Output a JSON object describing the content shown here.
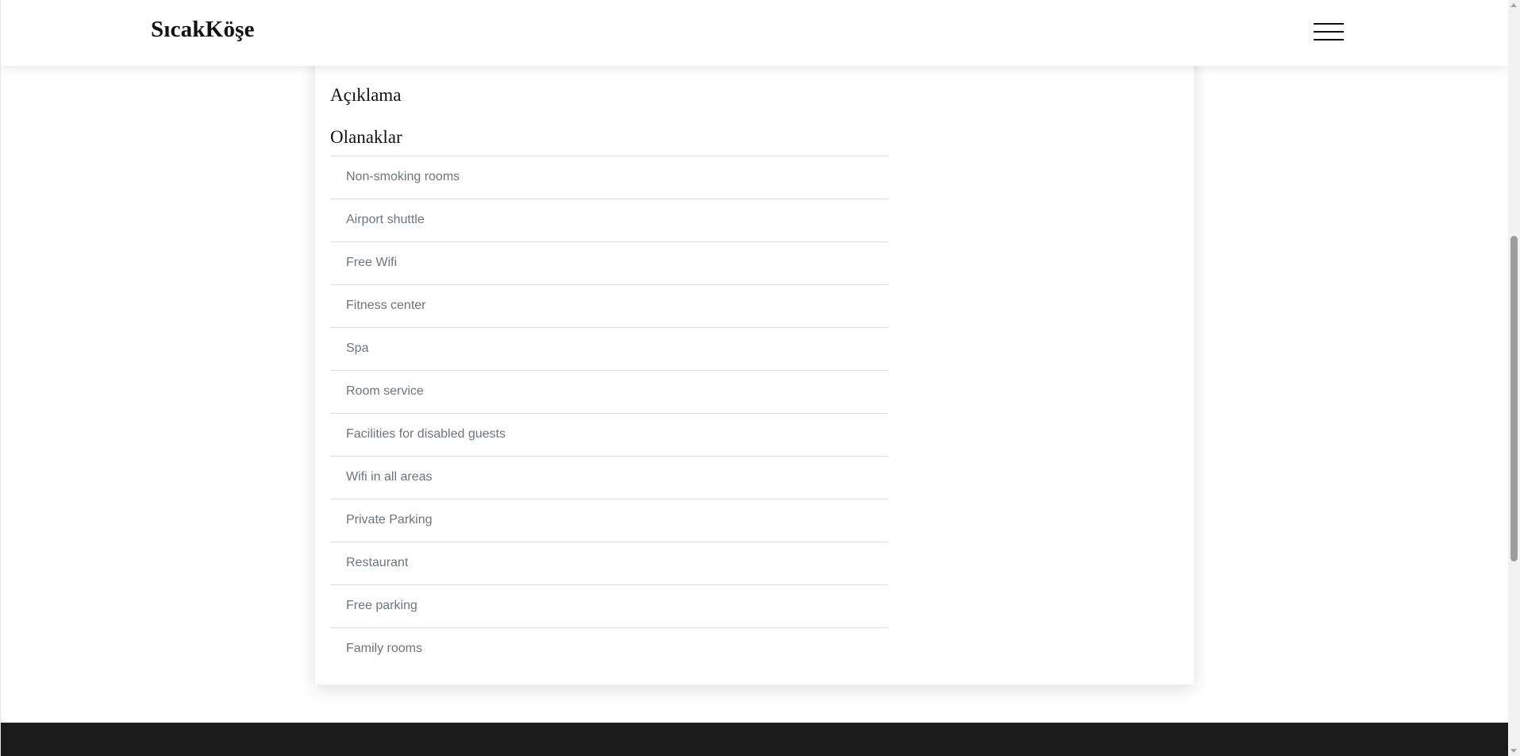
{
  "navbar": {
    "brand": "SıcakKöşe",
    "menu_icon": "hamburger-menu-icon"
  },
  "details": {
    "description_heading": "Açıklama",
    "amenities_heading": "Olanaklar",
    "amenities": [
      "Non-smoking rooms",
      "Airport shuttle",
      "Free Wifi",
      "Fitness center",
      "Spa",
      "Room service",
      "Facilities for disabled guests",
      "Wifi in all areas",
      "Private Parking",
      "Restaurant",
      "Free parking",
      "Family rooms"
    ]
  },
  "colors": {
    "footer": "#1b1b1b",
    "list_text": "#6c757d",
    "divider": "#dedede"
  }
}
